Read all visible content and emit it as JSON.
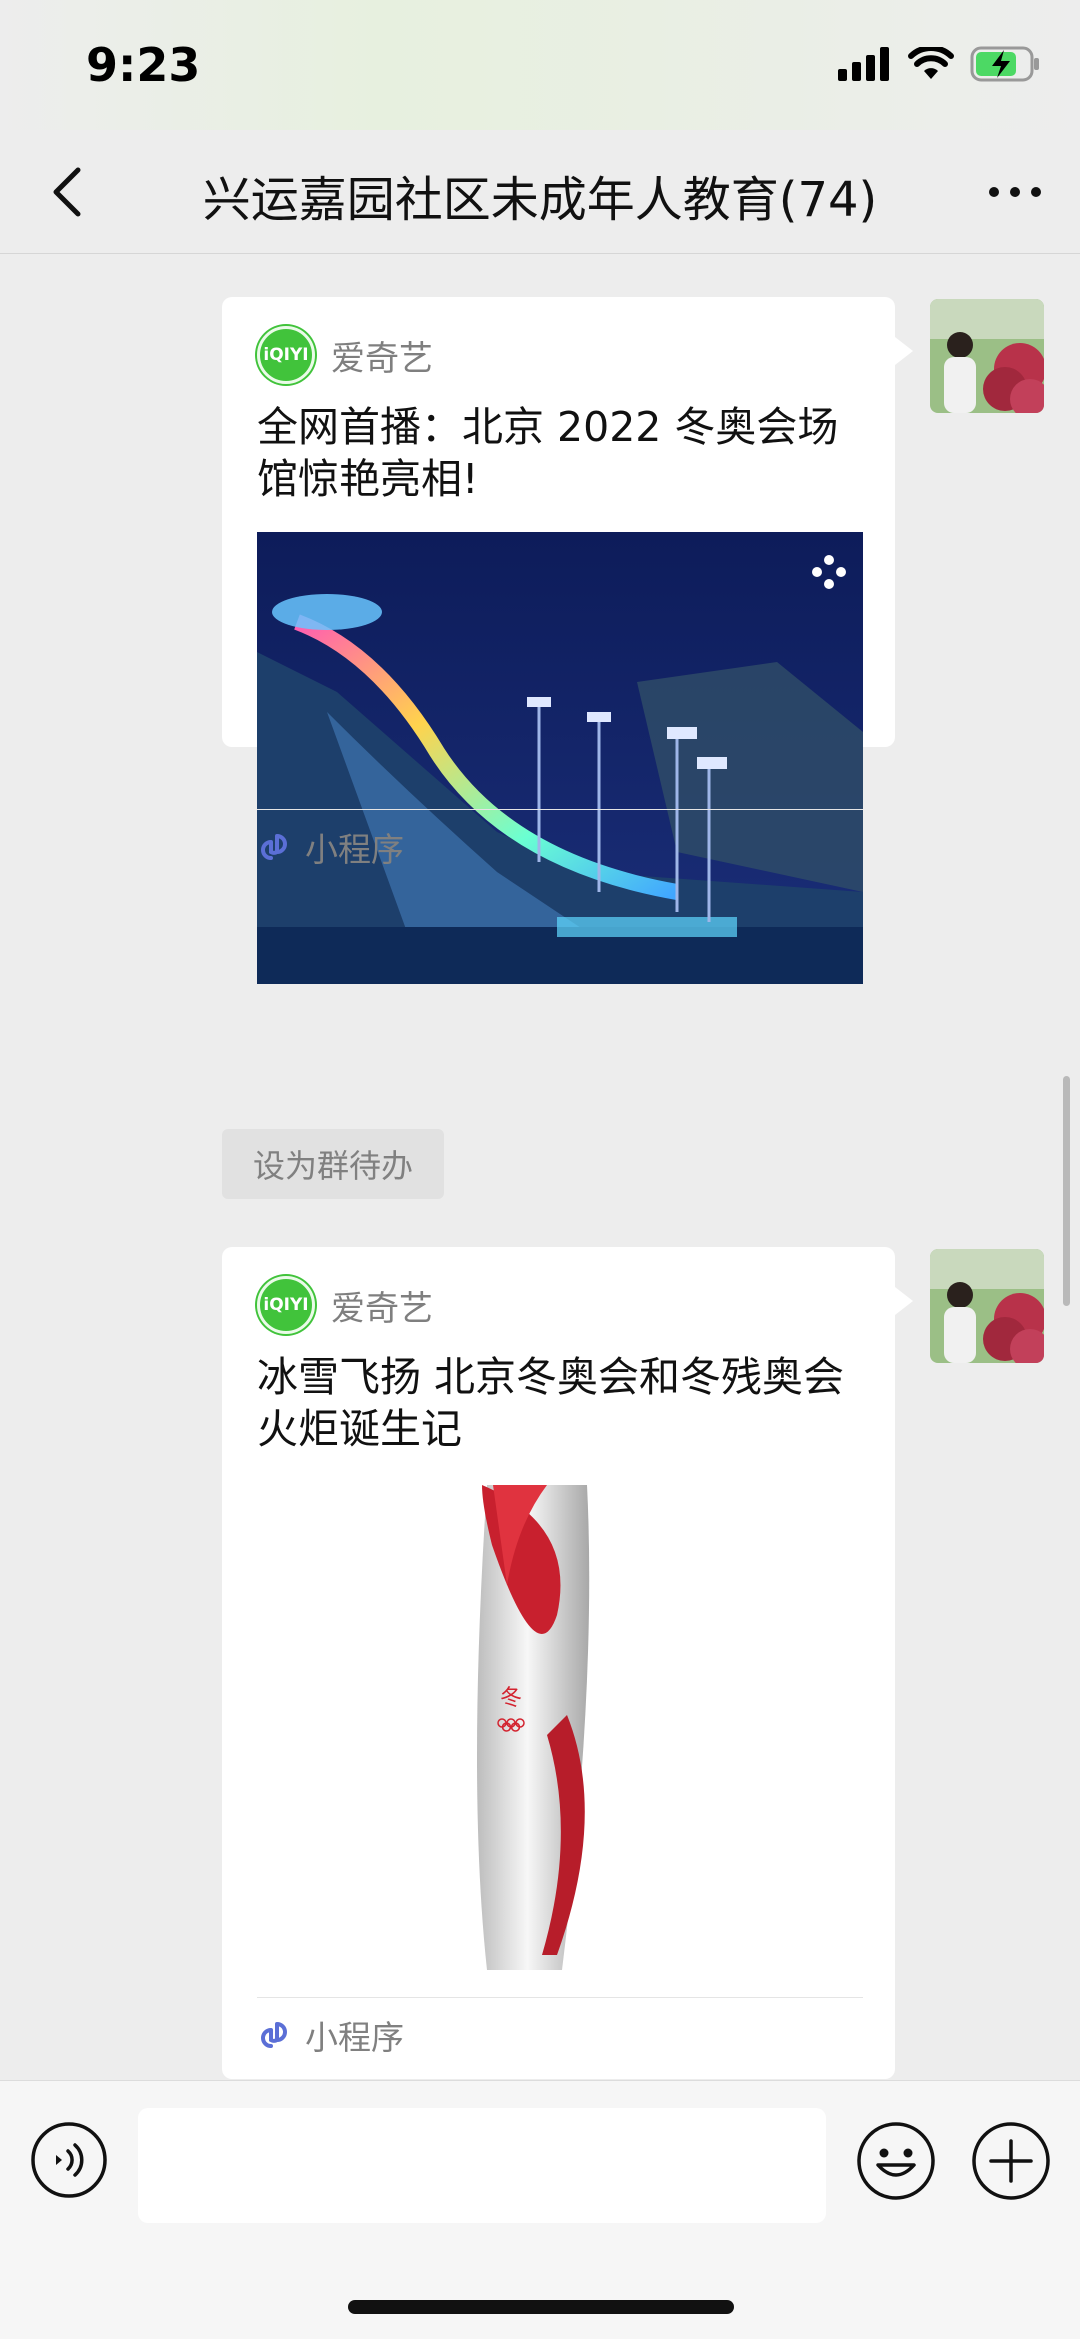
{
  "status_bar": {
    "time": "9:23"
  },
  "nav": {
    "title": "兴运嘉园社区未成年人教育(74)"
  },
  "messages": [
    {
      "app_name": "爱奇艺",
      "app_logo_text": "iQIYI",
      "title": "全网首播：北京 2022 冬奥会场馆惊艳亮相!",
      "footer_label": "小程序"
    },
    {
      "app_name": "爱奇艺",
      "app_logo_text": "iQIYI",
      "title": "冰雪飞扬 北京冬奥会和冬残奥会火炬诞生记",
      "footer_label": "小程序"
    }
  ],
  "todo_chip": {
    "label": "设为群待办"
  },
  "colors": {
    "accent_green": "#41c33b",
    "background": "#ededed",
    "bubble": "#ffffff"
  },
  "icons": [
    "back-chevron-icon",
    "more-dots-icon",
    "signal-icon",
    "wifi-icon",
    "battery-icon",
    "mini-program-link-icon",
    "voice-icon",
    "emoji-icon",
    "plus-icon"
  ]
}
